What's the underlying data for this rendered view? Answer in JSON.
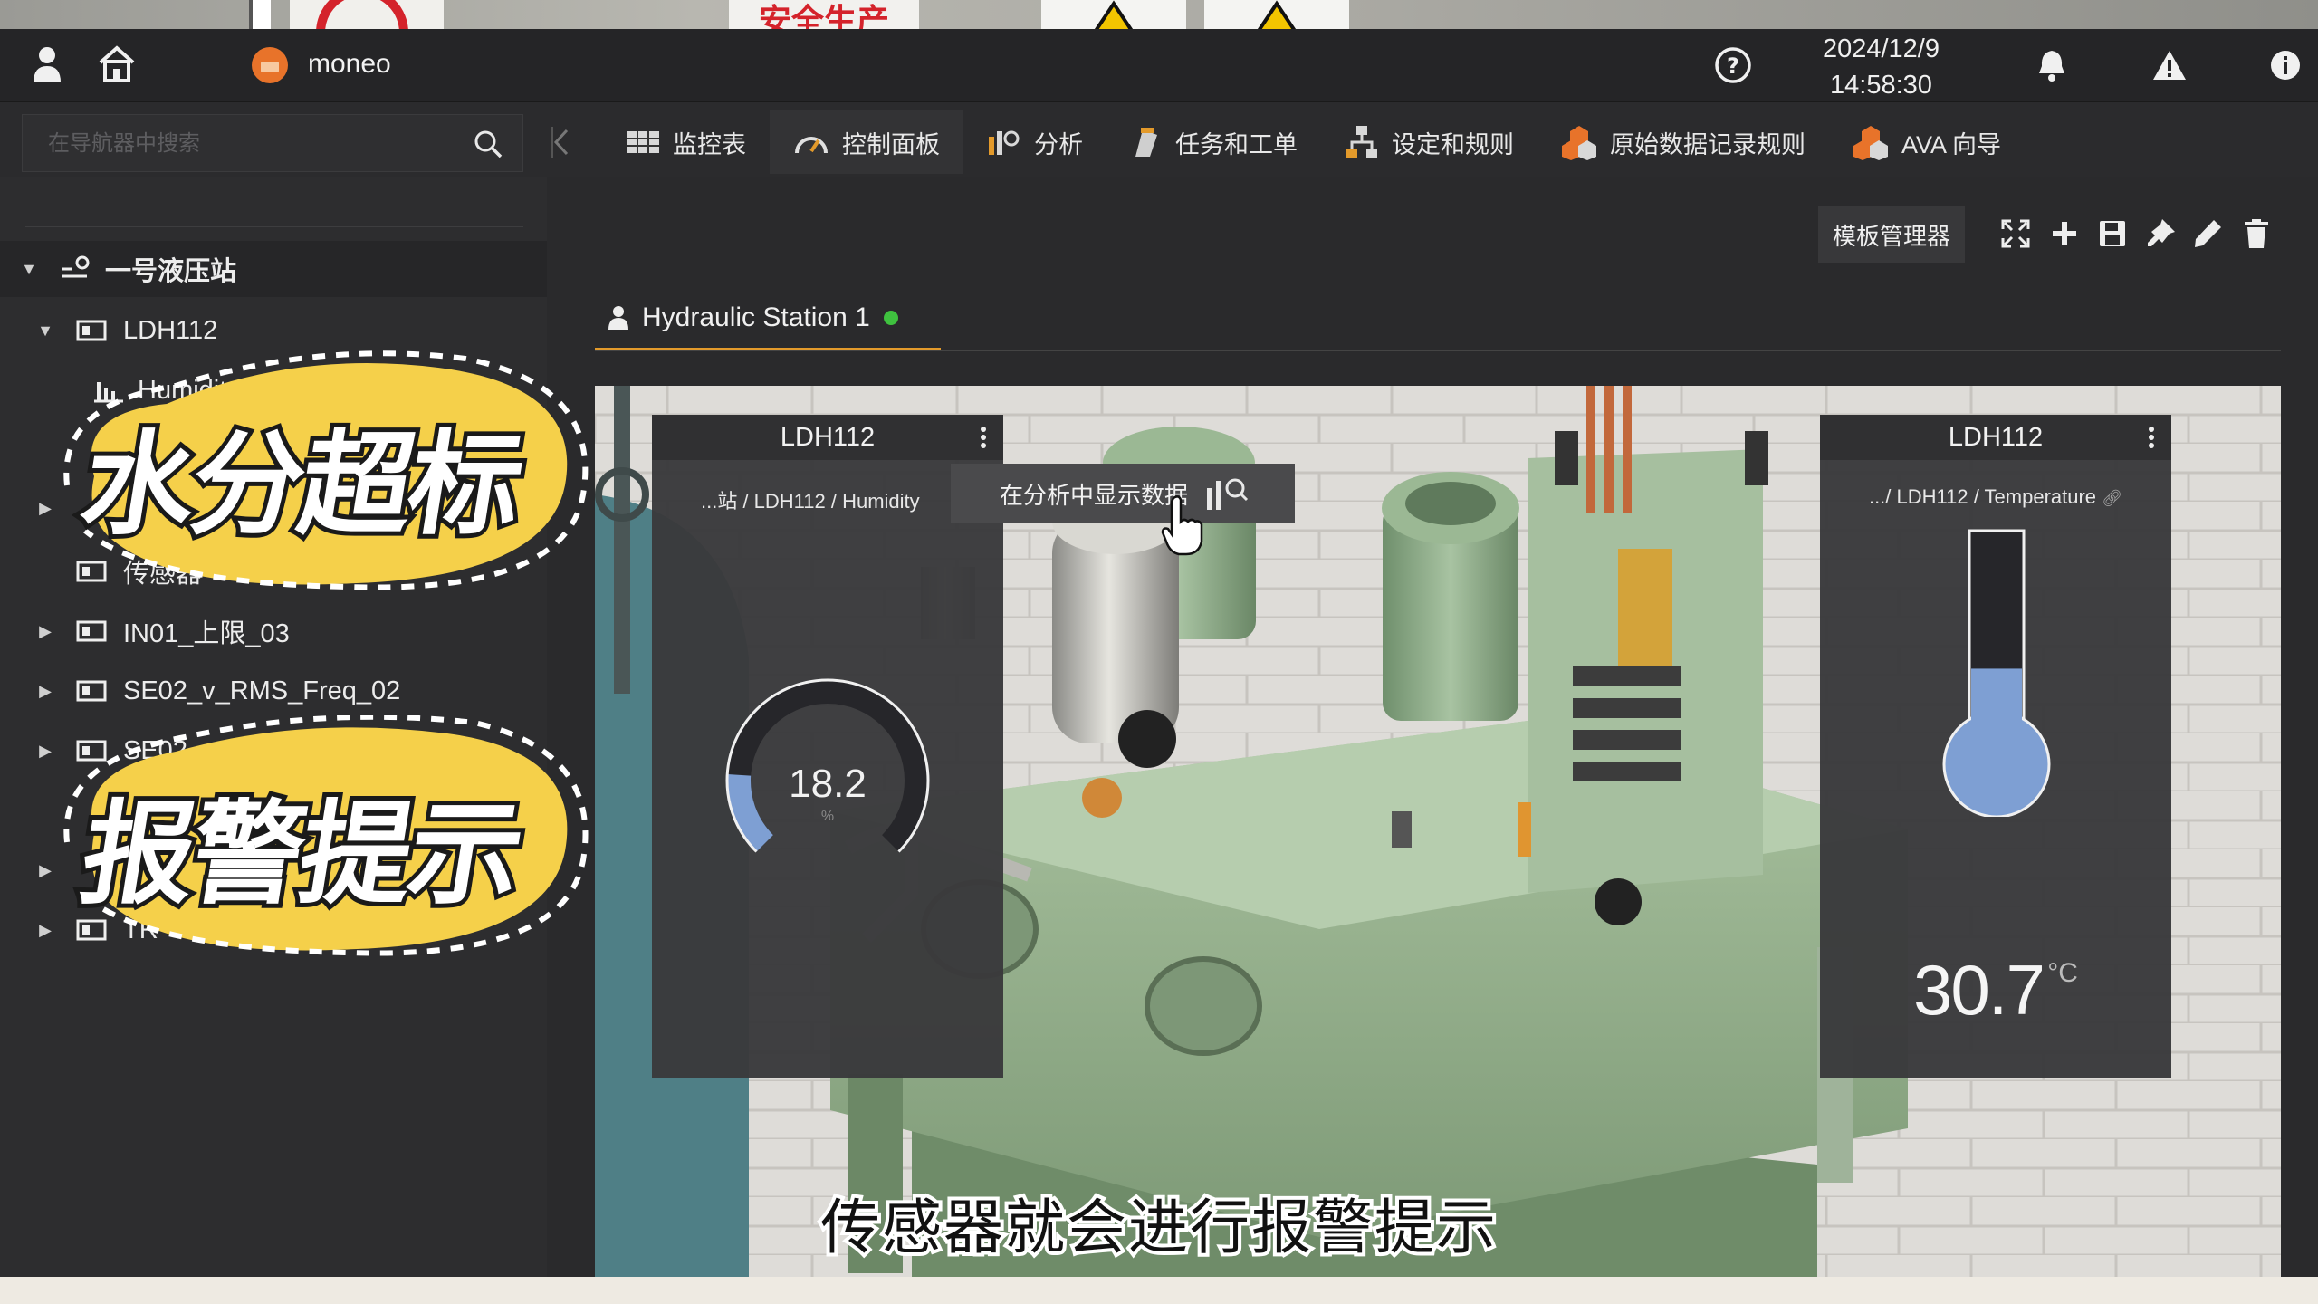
{
  "app": {
    "brand": "moneo",
    "date": "2024/12/9",
    "time": "14:58:30"
  },
  "background_signs": [
    "安全生产"
  ],
  "topbar_icons": [
    "user-icon",
    "home-icon",
    "help-icon",
    "bell-icon",
    "warning-icon",
    "info-icon"
  ],
  "search": {
    "placeholder": "在导航器中搜索"
  },
  "nav_tabs": [
    {
      "label": "监控表",
      "icon": "table-icon"
    },
    {
      "label": "控制面板",
      "icon": "gauge-icon",
      "active": true
    },
    {
      "label": "分析",
      "icon": "chart-icon"
    },
    {
      "label": "任务和工单",
      "icon": "task-icon"
    },
    {
      "label": "设定和规则",
      "icon": "hierarchy-icon"
    },
    {
      "label": "原始数据记录规则",
      "icon": "hex-icon"
    },
    {
      "label": "AVA 向导",
      "icon": "hex-icon"
    }
  ],
  "tree": {
    "root": "一号液压站",
    "items": [
      {
        "label": "LDH112"
      },
      {
        "label": "Humidity"
      },
      {
        "label": "传感器"
      },
      {
        "label": "IN01_上限_03"
      },
      {
        "label": "SE02_v_RMS_Freq_02"
      },
      {
        "label": "SE02_a_RMS_Fre"
      },
      {
        "label": "TR"
      }
    ]
  },
  "toolbar": {
    "template_manager": "模板管理器",
    "icons": [
      "fullscreen-icon",
      "add-icon",
      "save-icon",
      "pin-icon",
      "edit-icon",
      "delete-icon"
    ]
  },
  "dashboard_tab": {
    "label": "Hydraulic Station 1",
    "status_color": "#3fc13f"
  },
  "humidity_widget": {
    "title": "LDH112",
    "path": "...站 / LDH112 / Humidity",
    "value": "18.2",
    "unit": "%",
    "fill_fraction": 0.18
  },
  "tooltip": {
    "label": "在分析中显示数据"
  },
  "temperature_widget": {
    "title": "LDH112",
    "path": ".../ LDH112 / Temperature",
    "value": "30.7",
    "unit": "°C",
    "fill_fraction": 0.31
  },
  "overlay": {
    "sticker1": "水分超标",
    "sticker2": "报警提示",
    "subtitle": "传感器就会进行报警提示"
  },
  "colors": {
    "accent": "#e39a2b",
    "gauge_fill": "#7e9fd3",
    "status_ok": "#3fc13f"
  }
}
